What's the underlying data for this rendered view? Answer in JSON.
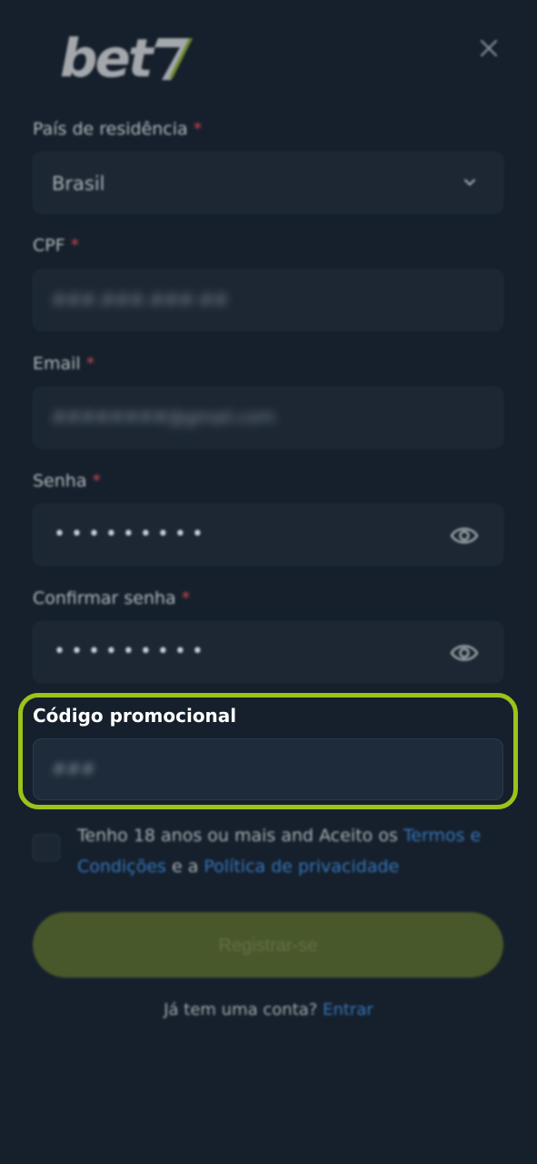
{
  "brand": {
    "logo_text": "bet",
    "logo_accent": "7"
  },
  "form": {
    "country": {
      "label": "País de residência",
      "required_mark": "*",
      "value": "Brasil"
    },
    "cpf": {
      "label": "CPF",
      "required_mark": "*",
      "value": "###.###.###-##"
    },
    "email": {
      "label": "Email",
      "required_mark": "*",
      "value": "########@gmail.com"
    },
    "password": {
      "label": "Senha",
      "required_mark": "*",
      "value": "•••••••••"
    },
    "confirm_password": {
      "label": "Confirmar senha",
      "required_mark": "*",
      "value": "•••••••••"
    },
    "promo_code": {
      "label": "Código promocional",
      "value": "###"
    }
  },
  "terms": {
    "text_1": "Tenho 18 anos ou mais and Aceito os ",
    "terms_link": "Termos e Condições",
    "text_2": " e a ",
    "privacy_link": "Política de privacidade"
  },
  "register_label": "Registrar-se",
  "login_prompt": {
    "text": "Já tem uma conta?",
    "link": "Entrar"
  },
  "colors": {
    "background": "#16202c",
    "highlight": "#9bc31a",
    "link": "#3574b8",
    "button": "#49582a"
  }
}
